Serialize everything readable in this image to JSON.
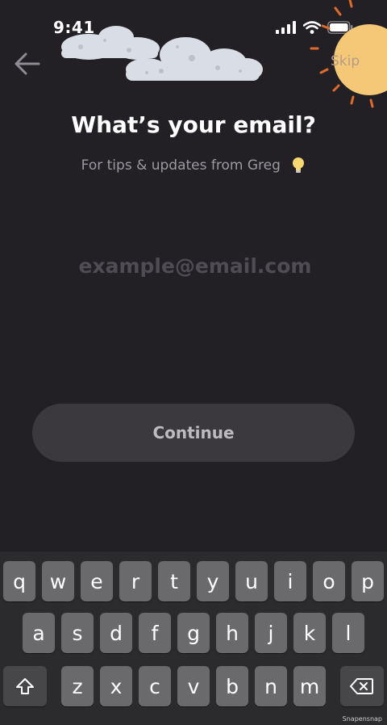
{
  "status_bar": {
    "time": "9:41"
  },
  "header": {
    "skip_label": "Skip"
  },
  "content": {
    "title": "What’s your email?",
    "subtitle": "For tips & updates from Greg",
    "email_placeholder": "example@email.com",
    "email_value": ""
  },
  "continue_label": "Continue",
  "keyboard": {
    "row1": [
      "q",
      "w",
      "e",
      "r",
      "t",
      "y",
      "u",
      "i",
      "o",
      "p"
    ],
    "row2": [
      "a",
      "s",
      "d",
      "f",
      "g",
      "h",
      "j",
      "k",
      "l"
    ],
    "row3": [
      "z",
      "x",
      "c",
      "v",
      "b",
      "n",
      "m"
    ]
  },
  "watermark": "Snapensnap",
  "colors": {
    "background": "#222024",
    "button": "#3b393e",
    "skip": "#b49c86",
    "sun": "#f5c878"
  }
}
